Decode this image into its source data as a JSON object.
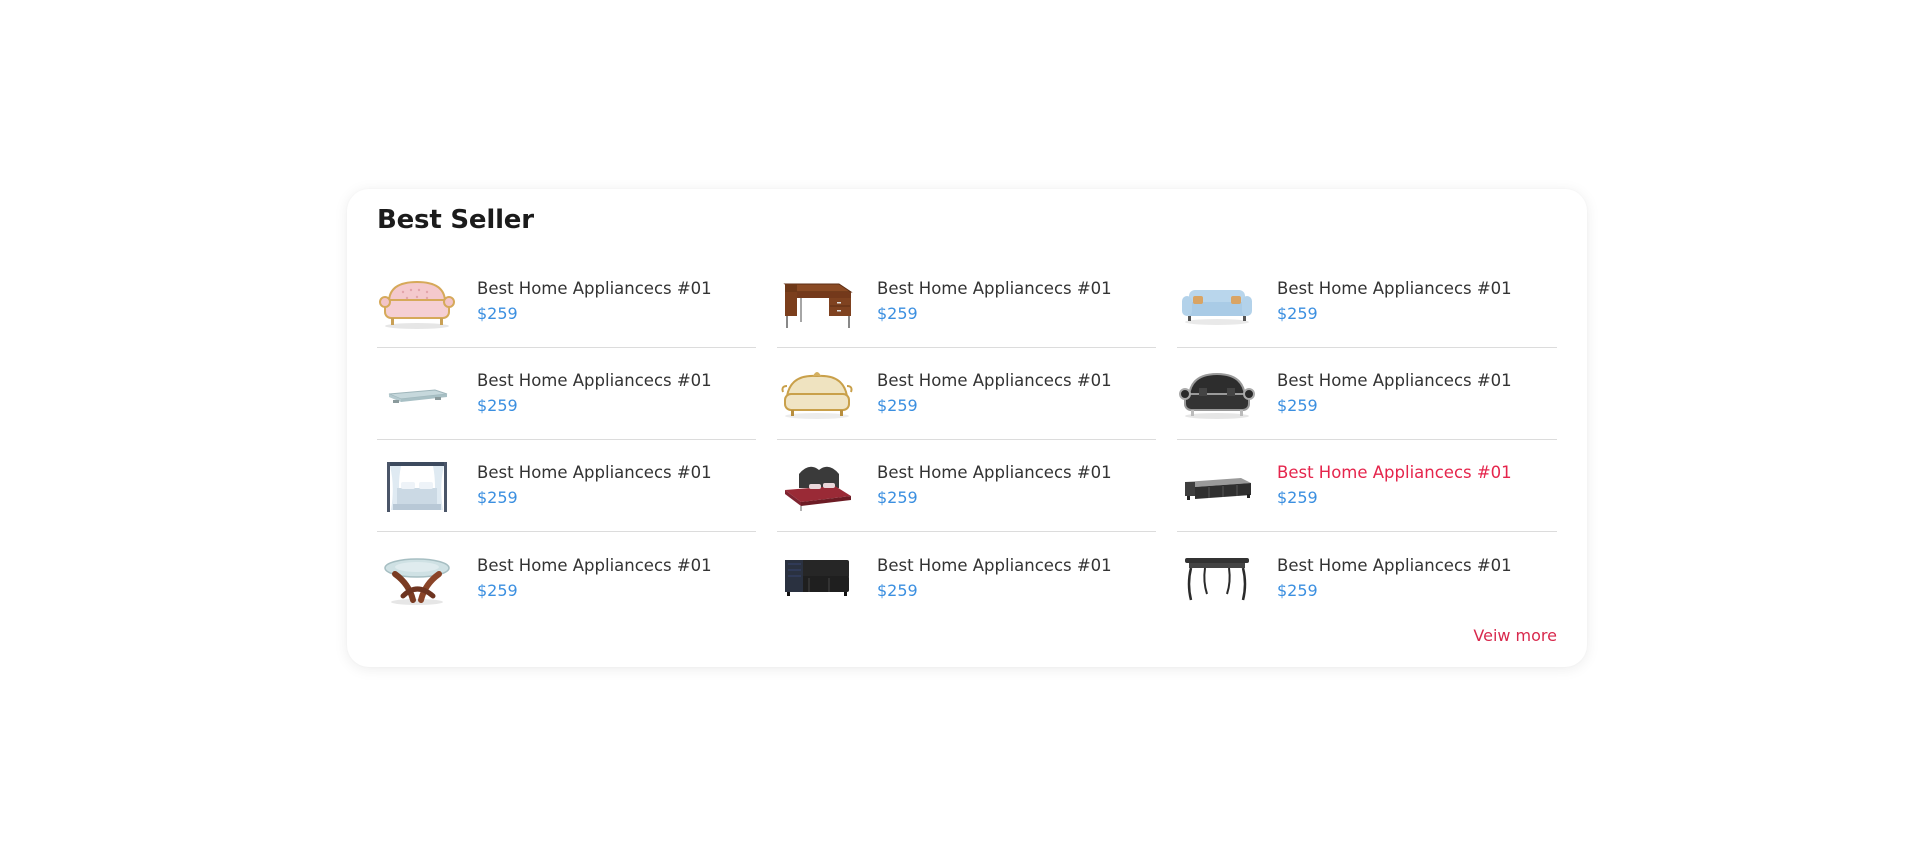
{
  "section": {
    "title": "Best Seller",
    "view_more_label": "Veiw more"
  },
  "accent_colors": {
    "price": "#3b8fe0",
    "highlight": "#e5254c"
  },
  "products": [
    {
      "name": "Best Home Appliancecs #01",
      "price": "$259",
      "icon": "pink-sofa-icon"
    },
    {
      "name": "Best Home Appliancecs #01",
      "price": "$259",
      "icon": "wooden-desk-icon"
    },
    {
      "name": "Best Home Appliancecs #01",
      "price": "$259",
      "icon": "blue-sofa-icon"
    },
    {
      "name": "Best Home Appliancecs #01",
      "price": "$259",
      "icon": "glass-table-icon"
    },
    {
      "name": "Best Home Appliancecs #01",
      "price": "$259",
      "icon": "cream-sofa-icon"
    },
    {
      "name": "Best Home Appliancecs #01",
      "price": "$259",
      "icon": "black-sofa-icon"
    },
    {
      "name": "Best Home Appliancecs #01",
      "price": "$259",
      "icon": "canopy-bed-icon"
    },
    {
      "name": "Best Home Appliancecs #01",
      "price": "$259",
      "icon": "red-bed-icon"
    },
    {
      "name": "Best Home Appliancecs #01",
      "price": "$259",
      "icon": "gray-tv-stand-icon",
      "highlighted": true
    },
    {
      "name": "Best Home Appliancecs #01",
      "price": "$259",
      "icon": "round-coffee-table-icon"
    },
    {
      "name": "Best Home Appliancecs #01",
      "price": "$259",
      "icon": "black-sectional-icon"
    },
    {
      "name": "Best Home Appliancecs #01",
      "price": "$259",
      "icon": "console-table-icon"
    }
  ]
}
